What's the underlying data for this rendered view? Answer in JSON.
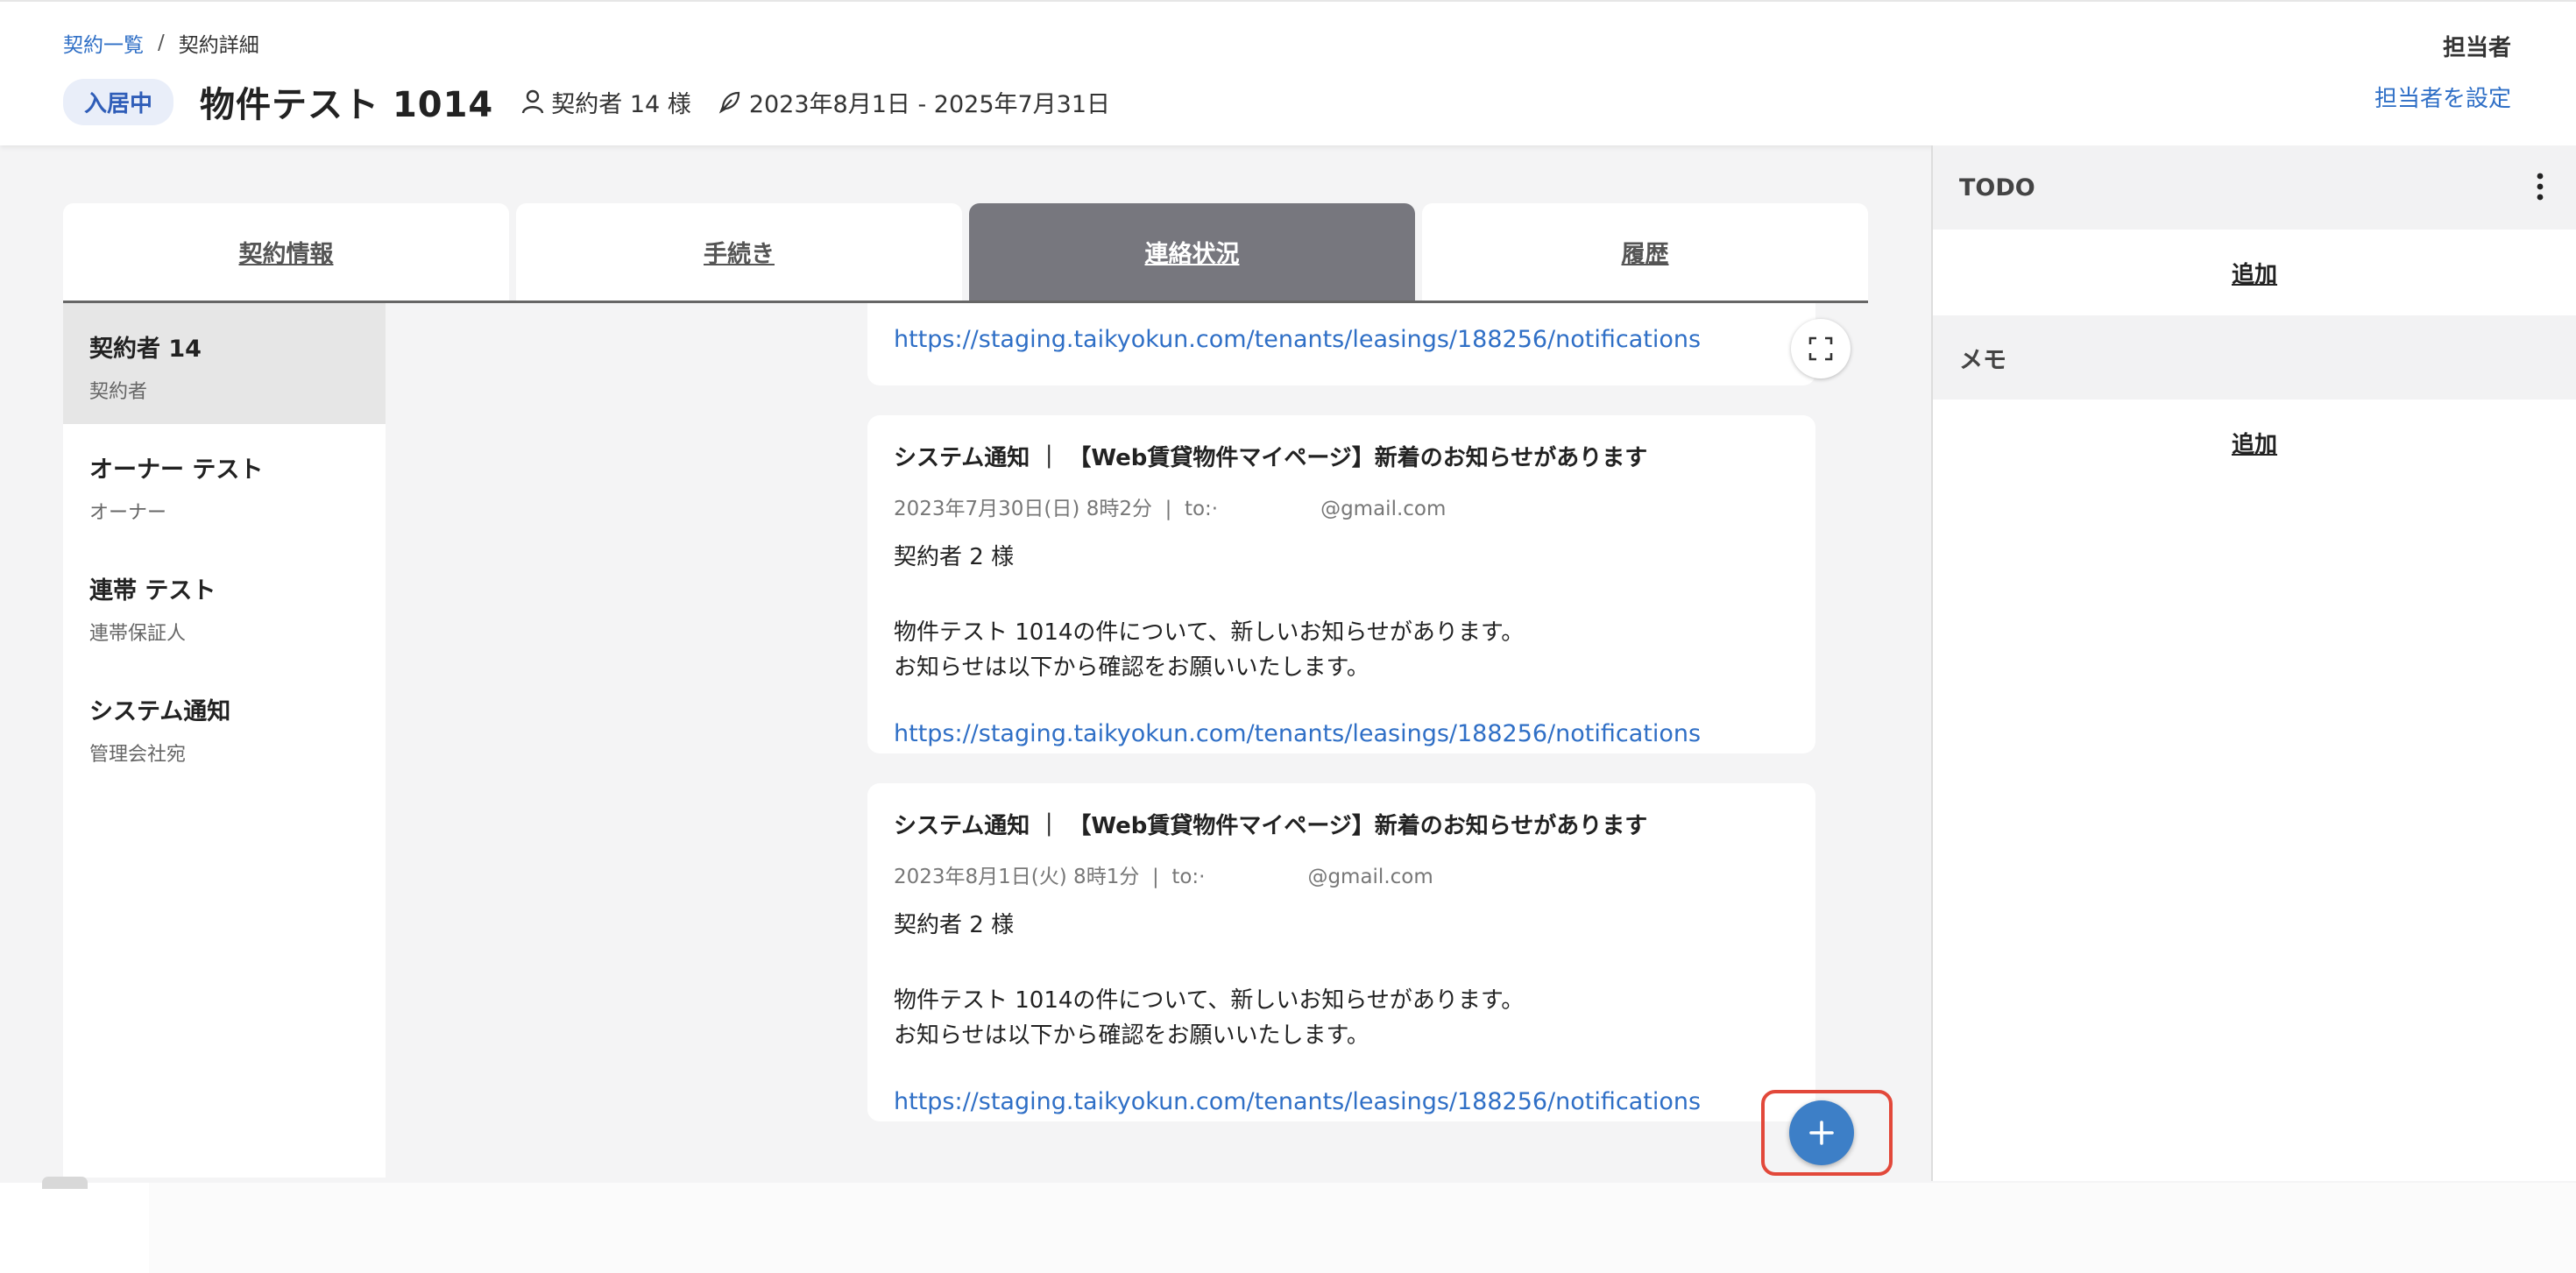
{
  "breadcrumb": {
    "list": "契約一覧",
    "separator": "/",
    "current": "契約詳細"
  },
  "header": {
    "status": "入居中",
    "title": "物件テスト 1014",
    "contractor": "契約者 14 様",
    "period": "2023年8月1日 - 2025年7月31日",
    "assignee_label": "担当者",
    "assignee_link": "担当者を設定"
  },
  "tabs": [
    {
      "label": "契約情報",
      "active": false
    },
    {
      "label": "手続き",
      "active": false
    },
    {
      "label": "連絡状況",
      "active": true
    },
    {
      "label": "履歴",
      "active": false
    }
  ],
  "contacts": [
    {
      "name": "契約者 14",
      "role": "契約者",
      "active": true
    },
    {
      "name": "オーナー テスト",
      "role": "オーナー",
      "active": false
    },
    {
      "name": "連帯 テスト",
      "role": "連帯保証人",
      "active": false
    },
    {
      "name": "システム通知",
      "role": "管理会社宛",
      "active": false
    }
  ],
  "messages": {
    "top_url": "https://staging.taikyokun.com/tenants/leasings/188256/notifications",
    "items": [
      {
        "subject": "システム通知 ｜ 【Web賃貸物件マイページ】新着のお知らせがあります",
        "date_line": "2023年7月30日(日) 8時2分  |  to:·                @gmail.com",
        "recipient": "契約者 2 様",
        "body_line1": "物件テスト 1014の件について、新しいお知らせがあります。",
        "body_line2": "お知らせは以下から確認をお願いいたします。",
        "url": "https://staging.taikyokun.com/tenants/leasings/188256/notifications"
      },
      {
        "subject": "システム通知 ｜ 【Web賃貸物件マイページ】新着のお知らせがあります",
        "date_line": "2023年8月1日(火) 8時1分  |  to:·                @gmail.com",
        "recipient": "契約者 2 様",
        "body_line1": "物件テスト 1014の件について、新しいお知らせがあります。",
        "body_line2": "お知らせは以下から確認をお願いいたします。",
        "url": "https://staging.taikyokun.com/tenants/leasings/188256/notifications"
      }
    ]
  },
  "right_panel": {
    "todo_title": "TODO",
    "todo_add": "追加",
    "memo_title": "メモ",
    "memo_add": "追加"
  },
  "colors": {
    "accent": "#2f6fc6",
    "fab": "#3d7fc7",
    "active_tab": "#77777e",
    "highlight": "#e2483a"
  }
}
